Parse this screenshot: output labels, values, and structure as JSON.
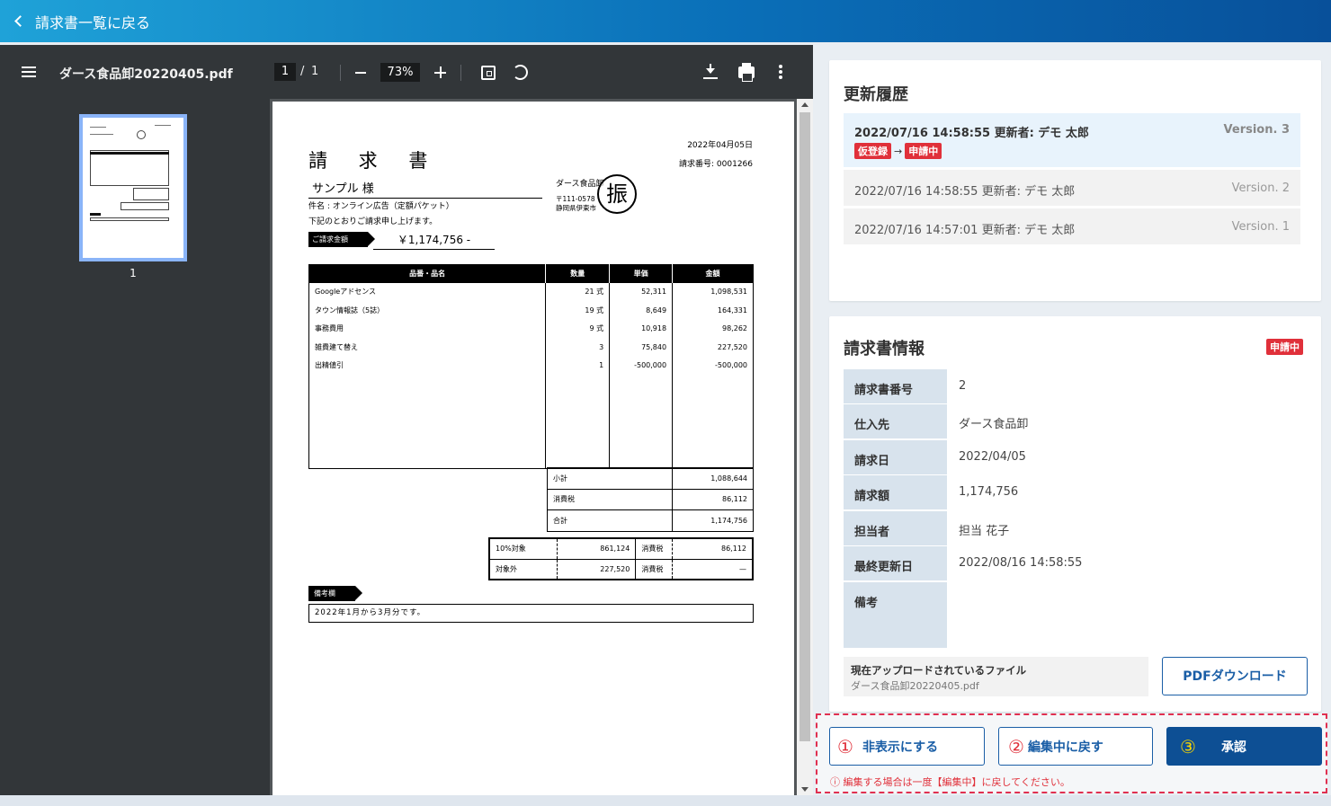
{
  "header": {
    "back_label": "請求書一覧に戻る"
  },
  "viewer": {
    "filename": "ダース食品卸20220405.pdf",
    "page_current": "1",
    "page_sep": "/",
    "page_total": "1",
    "zoom": "73%",
    "thumb_label": "1"
  },
  "invoice": {
    "date": "2022年04月05日",
    "number": "請求番号: 0001266",
    "title": "請 求 書",
    "to": "サンプル 様",
    "subject": "件名 : オンライン広告（定額パケット）",
    "request": "下記のとおりご請求申し上げます。",
    "amount_label": "ご請求金額",
    "amount": "￥1,174,756 -",
    "company": "ダース食品卸",
    "zip": "〒111-0578",
    "address": "静岡県伊東市",
    "stamp": "振",
    "columns": [
      "品番・品名",
      "数量",
      "単価",
      "金額"
    ],
    "items": [
      {
        "name": "Googleアドセンス",
        "qty": "21 式",
        "price": "52,311",
        "amount": "1,098,531"
      },
      {
        "name": "タウン情報誌（5誌）",
        "qty": "19 式",
        "price": "8,649",
        "amount": "164,331"
      },
      {
        "name": "事務費用",
        "qty": "9 式",
        "price": "10,918",
        "amount": "98,262"
      },
      {
        "name": "雑費建て替え",
        "qty": "3",
        "price": "75,840",
        "amount": "227,520"
      },
      {
        "name": "出精値引",
        "qty": "1",
        "price": "-500,000",
        "amount": "-500,000"
      }
    ],
    "totals": [
      {
        "label": "小計",
        "value": "1,088,644"
      },
      {
        "label": "消費税",
        "value": "86,112"
      },
      {
        "label": "合計",
        "value": "1,174,756"
      }
    ],
    "tax": [
      {
        "label": "10%対象",
        "value": "861,124",
        "tax_label": "消費税",
        "tax_value": "86,112"
      },
      {
        "label": "対象外",
        "value": "227,520",
        "tax_label": "消費税",
        "tax_value": "—"
      }
    ],
    "note_label": "備考欄",
    "note": "2022年1月から3月分です。"
  },
  "history": {
    "title": "更新履歴",
    "items": [
      {
        "text": "2022/07/16  14:58:55  更新者: デモ 太郎",
        "version": "Version. 3",
        "from": "仮登録",
        "arrow": "→",
        "to": "申請中"
      },
      {
        "text": "2022/07/16  14:58:55  更新者: デモ 太郎",
        "version": "Version. 2"
      },
      {
        "text": "2022/07/16  14:57:01  更新者: デモ 太郎",
        "version": "Version. 1"
      }
    ]
  },
  "info": {
    "title": "請求書情報",
    "status": "申請中",
    "rows": [
      {
        "label": "請求書番号",
        "value": "2"
      },
      {
        "label": "仕入先",
        "value": "ダース食品卸"
      },
      {
        "label": "請求日",
        "value": "2022/04/05"
      },
      {
        "label": "請求額",
        "value": "1,174,756"
      },
      {
        "label": "担当者",
        "value": "担当 花子"
      },
      {
        "label": "最終更新日",
        "value": "2022/08/16 14:58:55"
      },
      {
        "label": "備考",
        "value": ""
      }
    ],
    "file_label": "現在アップロードされているファイル",
    "file_name": "ダース食品卸20220405.pdf",
    "pdf_button": "PDFダウンロード"
  },
  "actions": {
    "hide": {
      "num": "①",
      "label": "非表示にする"
    },
    "revert": {
      "num": "②",
      "label": "編集中に戻す"
    },
    "approve": {
      "num": "③",
      "label": "承認"
    },
    "warning": "ⓘ 編集する場合は一度【編集中】に戻してください。"
  },
  "colors": {
    "accent": "#0d4f94",
    "badge": "#e0303a",
    "header_start": "#1fa2d8",
    "header_end": "#08509a"
  }
}
